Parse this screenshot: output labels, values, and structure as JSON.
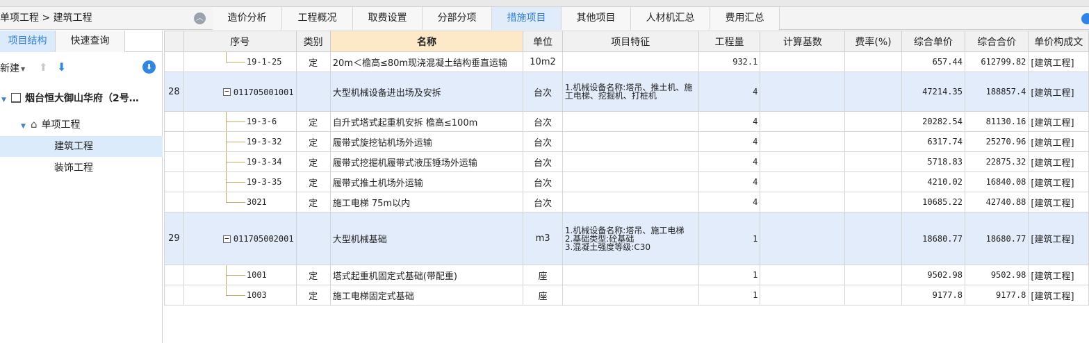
{
  "breadcrumb": "单项工程 > 建筑工程",
  "tabs": [
    "造价分析",
    "工程概况",
    "取费设置",
    "分部分项",
    "措施项目",
    "其他项目",
    "人材机汇总",
    "费用汇总"
  ],
  "active_tab": "措施项目",
  "left_panel": {
    "tabs": [
      "项目结构",
      "快速查询"
    ],
    "new_label": "新建",
    "tree": [
      {
        "label": "烟台恒大御山华府（2号…",
        "level": 0
      },
      {
        "label": "单项工程",
        "level": 1
      },
      {
        "label": "建筑工程",
        "level": 2,
        "selected": true
      },
      {
        "label": "装饰工程",
        "level": 2
      }
    ]
  },
  "table": {
    "headers": [
      "序号",
      "类别",
      "名称",
      "单位",
      "项目特征",
      "工程量",
      "计算基数",
      "费率(%)",
      "综合单价",
      "综合合价",
      "单价构成文"
    ],
    "rows": [
      {
        "no": "",
        "code": "19-1-25",
        "type": "定",
        "name": "20m＜檐高≤80m现浇混凝土结构垂直运输",
        "unit": "10m2",
        "feature": "",
        "qty": "932.1",
        "base": "",
        "rate": "",
        "price": "657.44",
        "total": "612799.82",
        "comp": "[建筑工程]"
      },
      {
        "no": "28",
        "code": "011705001001",
        "type": "",
        "name": "大型机械设备进出场及安拆",
        "unit": "台次",
        "feature": "1.机械设备名称:塔吊、推土机、施工电梯、挖掘机、打桩机",
        "qty": "4",
        "base": "",
        "rate": "",
        "price": "47214.35",
        "total": "188857.4",
        "comp": "[建筑工程]"
      },
      {
        "no": "",
        "code": "19-3-6",
        "type": "定",
        "name": "自升式塔式起重机安拆 檐高≤100m",
        "unit": "台次",
        "feature": "",
        "qty": "4",
        "base": "",
        "rate": "",
        "price": "20282.54",
        "total": "81130.16",
        "comp": "[建筑工程]"
      },
      {
        "no": "",
        "code": "19-3-32",
        "type": "定",
        "name": "履带式旋挖钻机场外运输",
        "unit": "台次",
        "feature": "",
        "qty": "4",
        "base": "",
        "rate": "",
        "price": "6317.74",
        "total": "25270.96",
        "comp": "[建筑工程]"
      },
      {
        "no": "",
        "code": "19-3-34",
        "type": "定",
        "name": "履带式挖掘机履带式液压锤场外运输",
        "unit": "台次",
        "feature": "",
        "qty": "4",
        "base": "",
        "rate": "",
        "price": "5718.83",
        "total": "22875.32",
        "comp": "[建筑工程]"
      },
      {
        "no": "",
        "code": "19-3-35",
        "type": "定",
        "name": "履带式推土机场外运输",
        "unit": "台次",
        "feature": "",
        "qty": "4",
        "base": "",
        "rate": "",
        "price": "4210.02",
        "total": "16840.08",
        "comp": "[建筑工程]"
      },
      {
        "no": "",
        "code": "3021",
        "type": "定",
        "name": "施工电梯 75m以内",
        "unit": "台次",
        "feature": "",
        "qty": "4",
        "base": "",
        "rate": "",
        "price": "10685.22",
        "total": "42740.88",
        "comp": "[建筑工程]"
      },
      {
        "no": "29",
        "code": "011705002001",
        "type": "",
        "name": "大型机械基础",
        "unit": "m3",
        "feature": "1.机械设备名称:塔吊、施工电梯\n2.基础类型:砼基础\n3.混凝土强度等级:C30",
        "qty": "1",
        "base": "",
        "rate": "",
        "price": "18680.77",
        "total": "18680.77",
        "comp": "[建筑工程]"
      },
      {
        "no": "",
        "code": "1001",
        "type": "定",
        "name": "塔式起重机固定式基础(带配重)",
        "unit": "座",
        "feature": "",
        "qty": "1",
        "base": "",
        "rate": "",
        "price": "9502.98",
        "total": "9502.98",
        "comp": "[建筑工程]"
      },
      {
        "no": "",
        "code": "1003",
        "type": "定",
        "name": "施工电梯固定式基础",
        "unit": "座",
        "feature": "",
        "qty": "1",
        "base": "",
        "rate": "",
        "price": "9177.8",
        "total": "9177.8",
        "comp": "[建筑工程]"
      }
    ]
  }
}
